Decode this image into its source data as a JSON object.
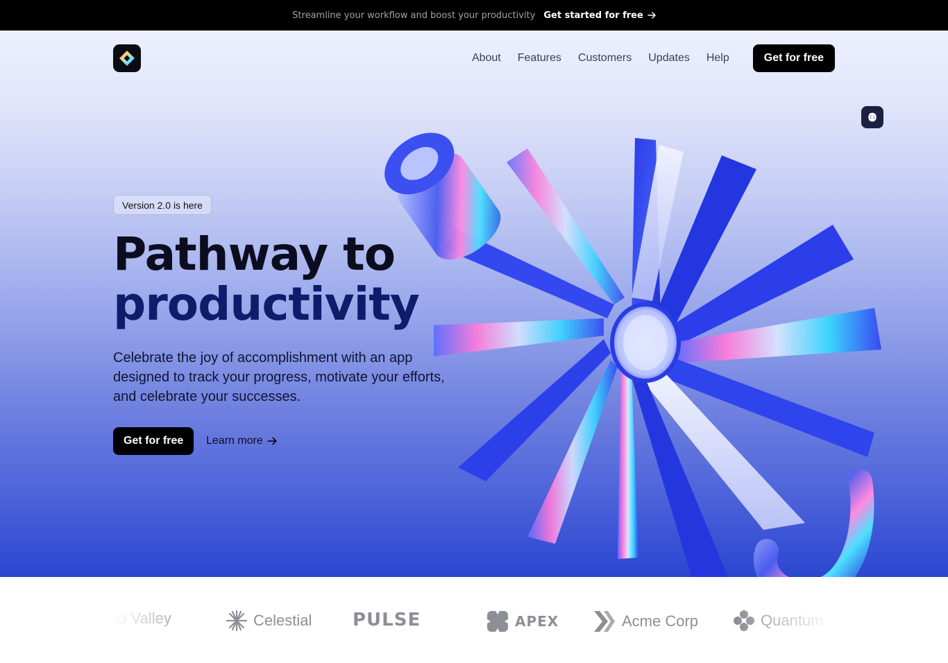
{
  "announcement": {
    "message": "Streamline your workflow and boost your productivity",
    "cta_label": "Get started for free",
    "cta_icon": "arrow-right-icon"
  },
  "nav": {
    "logo_icon": "diamond-logo-icon",
    "links": [
      "About",
      "Features",
      "Customers",
      "Updates",
      "Help"
    ],
    "cta_label": "Get for free"
  },
  "theme_toggle": {
    "icon": "brain-icon"
  },
  "hero": {
    "badge": "Version 2.0 is here",
    "headline_line1": "Pathway to",
    "headline_line2": "productivity",
    "subheadline": "Celebrate the joy of accomplishment with an app designed to track your progress, motivate your efforts, and celebrate your successes.",
    "primary_cta": "Get for free",
    "secondary_cta": "Learn more",
    "secondary_icon": "arrow-right-icon"
  },
  "customer_logos": [
    {
      "name": "Echo Valley",
      "visible_text": "no Valley",
      "icon": "none"
    },
    {
      "name": "Celestial",
      "icon": "asterisk-icon"
    },
    {
      "name": "PULSE",
      "icon": "none"
    },
    {
      "name": "APEX",
      "icon": "apex-shape-icon"
    },
    {
      "name": "Acme Corp",
      "icon": "chevrons-icon"
    },
    {
      "name": "Quantum",
      "icon": "flower-icon"
    }
  ],
  "colors": {
    "topbar_bg": "#000000",
    "button_bg": "#000000",
    "hero_top": "#eceffd",
    "hero_bottom": "#2b46d0",
    "headline_accent": "#0f1c6b",
    "logo_gray": "#8e8e96"
  }
}
